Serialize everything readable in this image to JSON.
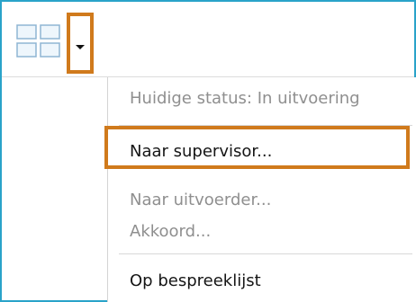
{
  "toolbar": {
    "grid_icon": "grid-view-icon",
    "dropdown_icon": "caret-down-icon"
  },
  "menu": {
    "items": [
      {
        "label": "Huidige status: In uitvoering",
        "enabled": false
      },
      {
        "label": "Naar supervisor...",
        "enabled": true,
        "highlighted": true
      },
      {
        "label": "Naar uitvoerder...",
        "enabled": false
      },
      {
        "label": "Akkoord...",
        "enabled": false
      },
      {
        "label": "Op bespreeklijst",
        "enabled": true
      }
    ]
  },
  "colors": {
    "frame_border": "#2aa3c9",
    "highlight_border": "#d07a1c",
    "disabled_text": "#8f8f8f",
    "enabled_text": "#151515"
  }
}
